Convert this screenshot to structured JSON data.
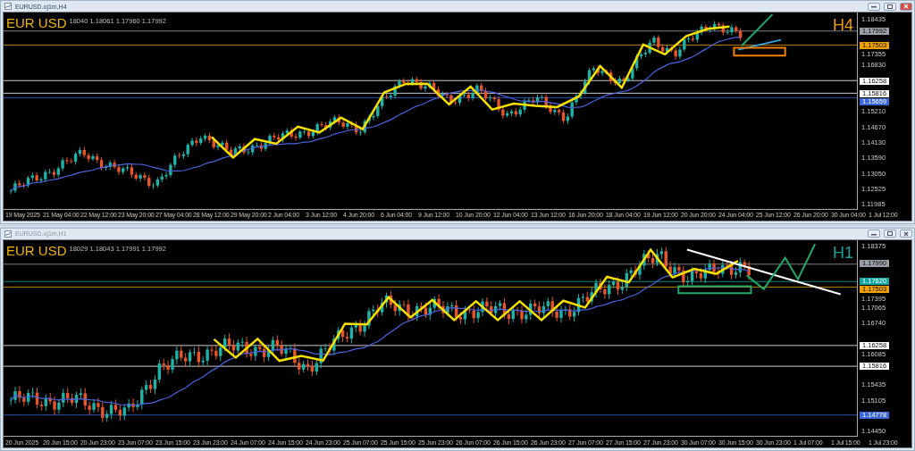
{
  "windows": [
    {
      "title": "EURUSD.oj1m,H4",
      "active": true,
      "symbol": "EUR USD",
      "quote": "18040 1.18061 1.17960 1.17992",
      "timeframe": "H4",
      "price_ticks": [
        "1.18435",
        "1.17355",
        "1.16830",
        "1.15210",
        "1.14670",
        "1.14130",
        "1.13590",
        "1.13050",
        "1.12525",
        "1.11985"
      ],
      "levels": [
        {
          "price": "1.17992",
          "color": "#9aa0a8"
        },
        {
          "price": "1.17503",
          "color": "#f0a000"
        },
        {
          "price": "1.16258",
          "color": "#ffffff"
        },
        {
          "price": "1.15816",
          "color": "#ffffff"
        },
        {
          "price": "1.15659",
          "color": "#3a66d8"
        }
      ],
      "time_labels": [
        "19 May 2025",
        "21 May 04:00",
        "22 May 12:00",
        "23 May 20:00",
        "27 May 04:00",
        "28 May 12:00",
        "29 May 20:00",
        "2 Jun 04:00",
        "3 Jun 12:00",
        "4 Jun 20:00",
        "6 Jun 04:00",
        "9 Jun 12:00",
        "10 Jun 20:00",
        "12 Jun 04:00",
        "13 Jun 12:00",
        "16 Jun 20:00",
        "18 Jun 04:00",
        "19 Jun 12:00",
        "20 Jun 20:00",
        "24 Jun 04:00",
        "25 Jun 12:00",
        "26 Jun 20:00",
        "30 Jun 04:00",
        "1 Jul 12:00"
      ]
    },
    {
      "title": "EURUSD.oj1m,H1",
      "active": false,
      "symbol": "EUR USD",
      "quote": "18029 1.18043 1.17991 1.17992",
      "timeframe": "H1",
      "price_ticks": [
        "1.18375",
        "1.17395",
        "1.17065",
        "1.16740",
        "1.16085",
        "1.15435",
        "1.15105",
        "1.14450"
      ],
      "levels": [
        {
          "price": "1.17990",
          "color": "#9aa0a8"
        },
        {
          "price": "1.17620",
          "color": "#12a7a0"
        },
        {
          "price": "1.17503",
          "color": "#f0a000"
        },
        {
          "price": "1.16258",
          "color": "#ffffff"
        },
        {
          "price": "1.15816",
          "color": "#ffffff"
        },
        {
          "price": "1.14778",
          "color": "#3a66d8"
        }
      ],
      "time_labels": [
        "20 Jun 2025",
        "20 Jun 15:00",
        "20 Jun 23:00",
        "23 Jun 07:00",
        "23 Jun 15:00",
        "23 Jun 23:00",
        "24 Jun 07:00",
        "24 Jun 15:00",
        "24 Jun 23:00",
        "25 Jun 07:00",
        "25 Jun 15:00",
        "25 Jun 23:00",
        "26 Jun 07:00",
        "26 Jun 15:00",
        "26 Jun 23:00",
        "27 Jun 07:00",
        "27 Jun 15:00",
        "27 Jun 23:00",
        "30 Jun 07:00",
        "30 Jun 15:00",
        "30 Jun 23:00",
        "1 Jul 07:00",
        "1 Jul 15:00",
        "1 Jul 23:00"
      ]
    }
  ]
}
